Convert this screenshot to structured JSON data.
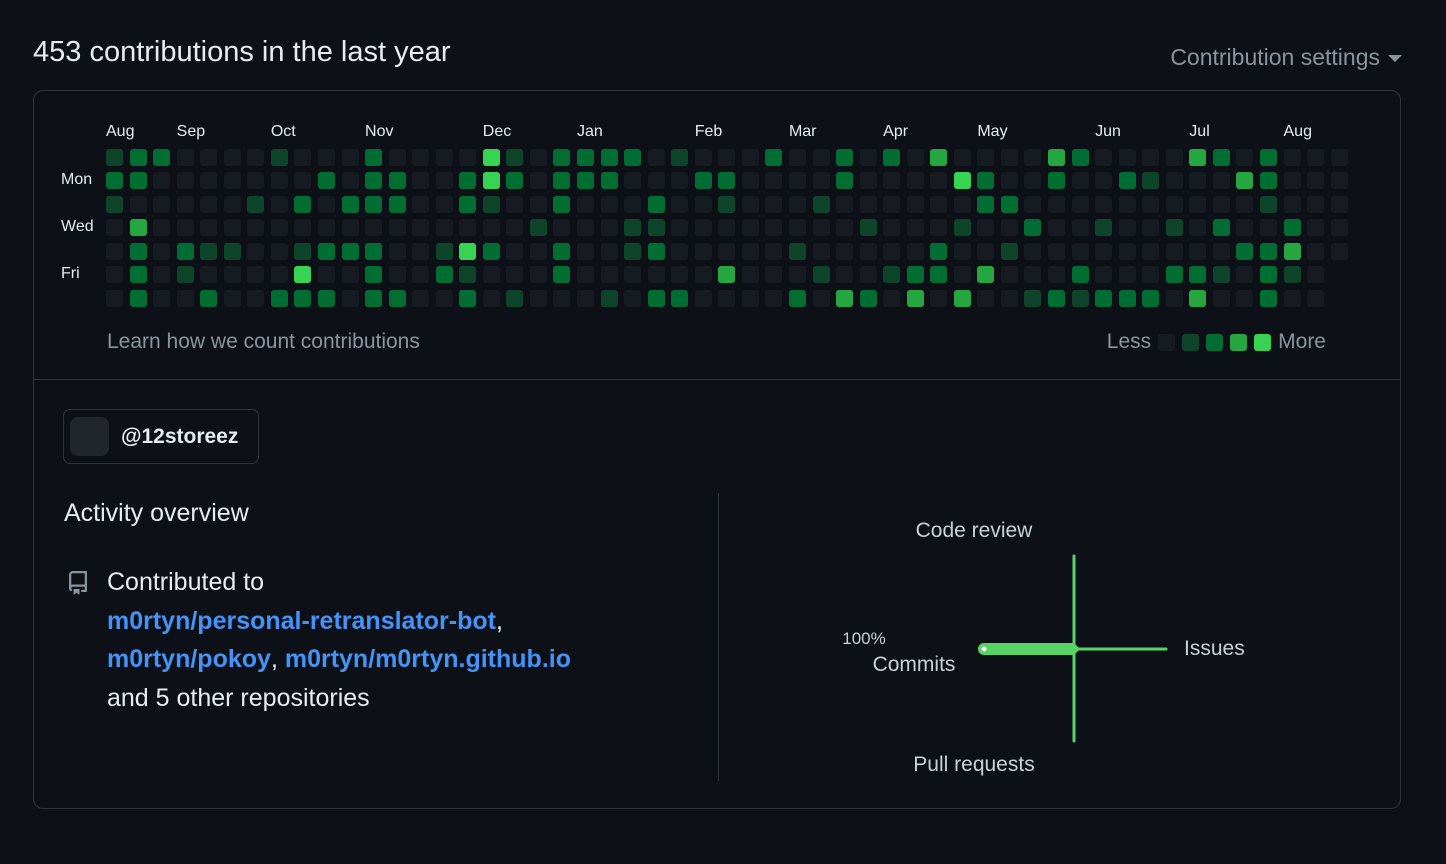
{
  "header": {
    "title": "453 contributions in the last year",
    "settings_label": "Contribution settings"
  },
  "calendar": {
    "months": [
      "Aug",
      "Sep",
      "Oct",
      "Nov",
      "Dec",
      "Jan",
      "Feb",
      "Mar",
      "Apr",
      "May",
      "Jun",
      "Jul",
      "Aug"
    ],
    "month_start_weeks": [
      0,
      3,
      7,
      11,
      16,
      20,
      25,
      29,
      33,
      37,
      42,
      46,
      50
    ],
    "day_labels": [
      {
        "label": "Mon",
        "row": 1
      },
      {
        "label": "Wed",
        "row": 3
      },
      {
        "label": "Fri",
        "row": 5
      }
    ],
    "weeks": 53,
    "levels": [
      "00000000000000000000000000000000000000000000000000000",
      "00000000000000000000000000000000000000000000000000000",
      "00000000000000000000000000000000000000000000000000000",
      "00000000000000000000000000000000000000000000000000000",
      "00000000000000000000000000000000000000000000000000000",
      "00000000000000000000000000000000000000000000000000000",
      "00000000000000000000000000000000000000000000000000000"
    ],
    "cells_lvl1": [
      [
        0,
        0
      ],
      [
        0,
        1
      ],
      [
        0,
        2
      ],
      [
        1,
        4
      ],
      [
        3,
        5
      ],
      [
        4,
        4
      ],
      [
        5,
        4
      ],
      [
        6,
        2
      ],
      [
        7,
        0
      ],
      [
        8,
        4
      ],
      [
        9,
        6
      ],
      [
        10,
        4
      ],
      [
        12,
        1
      ],
      [
        14,
        4
      ],
      [
        15,
        5
      ],
      [
        16,
        2
      ],
      [
        17,
        0
      ],
      [
        17,
        6
      ],
      [
        18,
        3
      ],
      [
        19,
        4
      ],
      [
        21,
        6
      ],
      [
        22,
        3
      ],
      [
        22,
        4
      ],
      [
        23,
        3
      ],
      [
        24,
        0
      ],
      [
        26,
        2
      ],
      [
        29,
        4
      ],
      [
        30,
        2
      ],
      [
        30,
        5
      ],
      [
        32,
        3
      ],
      [
        33,
        5
      ],
      [
        36,
        3
      ],
      [
        38,
        4
      ],
      [
        39,
        6
      ],
      [
        41,
        6
      ],
      [
        42,
        3
      ],
      [
        44,
        1
      ],
      [
        45,
        3
      ],
      [
        47,
        5
      ],
      [
        49,
        2
      ],
      [
        50,
        5
      ]
    ],
    "cells_lvl2": [
      [
        0,
        1
      ],
      [
        1,
        0
      ],
      [
        1,
        1
      ],
      [
        1,
        4
      ],
      [
        1,
        5
      ],
      [
        1,
        6
      ],
      [
        2,
        0
      ],
      [
        3,
        4
      ],
      [
        4,
        6
      ],
      [
        7,
        6
      ],
      [
        8,
        2
      ],
      [
        8,
        6
      ],
      [
        9,
        1
      ],
      [
        9,
        4
      ],
      [
        9,
        6
      ],
      [
        10,
        2
      ],
      [
        10,
        4
      ],
      [
        11,
        0
      ],
      [
        11,
        1
      ],
      [
        11,
        2
      ],
      [
        11,
        4
      ],
      [
        11,
        5
      ],
      [
        11,
        6
      ],
      [
        12,
        1
      ],
      [
        12,
        2
      ],
      [
        12,
        6
      ],
      [
        14,
        5
      ],
      [
        15,
        1
      ],
      [
        15,
        2
      ],
      [
        15,
        6
      ],
      [
        16,
        4
      ],
      [
        17,
        1
      ],
      [
        19,
        0
      ],
      [
        19,
        1
      ],
      [
        19,
        2
      ],
      [
        19,
        4
      ],
      [
        19,
        5
      ],
      [
        20,
        0
      ],
      [
        20,
        1
      ],
      [
        21,
        0
      ],
      [
        21,
        1
      ],
      [
        22,
        0
      ],
      [
        23,
        2
      ],
      [
        23,
        4
      ],
      [
        23,
        6
      ],
      [
        24,
        6
      ],
      [
        25,
        1
      ],
      [
        26,
        1
      ],
      [
        28,
        0
      ],
      [
        29,
        6
      ],
      [
        31,
        0
      ],
      [
        31,
        1
      ],
      [
        32,
        6
      ],
      [
        33,
        0
      ],
      [
        34,
        5
      ],
      [
        35,
        4
      ],
      [
        35,
        5
      ],
      [
        36,
        1
      ],
      [
        37,
        1
      ],
      [
        37,
        2
      ],
      [
        38,
        2
      ],
      [
        39,
        3
      ],
      [
        40,
        1
      ],
      [
        40,
        6
      ],
      [
        41,
        0
      ],
      [
        41,
        5
      ],
      [
        42,
        6
      ],
      [
        43,
        1
      ],
      [
        43,
        6
      ],
      [
        44,
        6
      ],
      [
        45,
        5
      ],
      [
        46,
        5
      ],
      [
        46,
        6
      ],
      [
        47,
        0
      ],
      [
        47,
        3
      ],
      [
        48,
        4
      ],
      [
        49,
        0
      ],
      [
        49,
        1
      ],
      [
        49,
        4
      ],
      [
        49,
        5
      ],
      [
        49,
        6
      ],
      [
        50,
        3
      ]
    ],
    "cells_lvl3": [
      [
        1,
        3
      ],
      [
        8,
        5
      ],
      [
        26,
        5
      ],
      [
        31,
        6
      ],
      [
        34,
        6
      ],
      [
        35,
        0
      ],
      [
        36,
        6
      ],
      [
        37,
        5
      ],
      [
        40,
        0
      ],
      [
        46,
        0
      ],
      [
        46,
        6
      ],
      [
        48,
        1
      ],
      [
        50,
        4
      ]
    ],
    "cells_lvl4": [
      [
        16,
        0
      ],
      [
        16,
        1
      ],
      [
        15,
        4
      ],
      [
        8,
        5
      ],
      [
        36,
        1
      ]
    ],
    "learn_label": "Learn how we count contributions",
    "legend_less": "Less",
    "legend_more": "More",
    "colors": [
      "#161b22",
      "#0e4429",
      "#006d32",
      "#26a641",
      "#39d353"
    ]
  },
  "user": {
    "handle": "@12storeez"
  },
  "activity": {
    "title": "Activity overview",
    "contributed_to": "Contributed to",
    "repos": [
      "m0rtyn/personal-retranslator-bot",
      "m0rtyn/pokoy",
      "m0rtyn/m0rtyn.github.io"
    ],
    "others": "and 5 other repositories"
  },
  "chart_data": {
    "type": "scatter",
    "title": "",
    "axes": [
      "Code review",
      "Issues",
      "Pull requests",
      "Commits"
    ],
    "values": {
      "Commits": 100,
      "Code review": 0,
      "Issues": 0,
      "Pull requests": 0
    },
    "labels": {
      "Commits_pct": "100%"
    },
    "color": "#56d364"
  }
}
